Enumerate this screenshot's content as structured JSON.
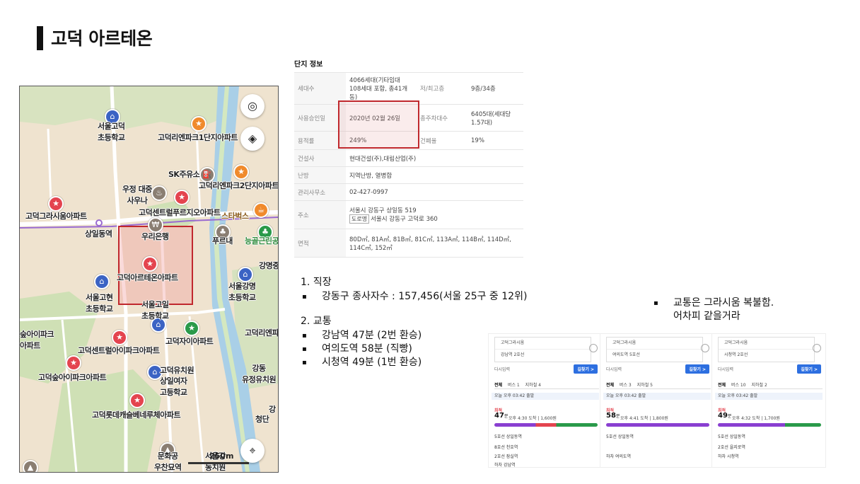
{
  "title": "고덕 아르테온",
  "map": {
    "labels": {
      "seoul_godeok_elem": "서울고덕\n초등학교",
      "ienpark1": "고덕리엔파크1단지아파트",
      "sk": "SK주유소",
      "ujeong": "우정 대중\n사우나",
      "ienpark2": "고덕리엔파크2단지아파트",
      "gracium": "고덕그라시움아파트",
      "centrepruzio": "고덕센트럴푸르지오아파트",
      "starbucks": "스타벅스",
      "sangil_stn": "상일동역",
      "woori": "우리은행",
      "purene": "푸르내",
      "neunggol": "능골근린공",
      "gangmyeong_short": "강명중",
      "arteon": "고덕아르테온아파트",
      "gangmyeong_elem": "서울강명\n초등학교",
      "godeok_high_elem": "서울고현\n초등학교",
      "godeok_il_elem": "서울고일\n초등학교",
      "zai": "고덕자이아파트",
      "ienpark_right": "고덕리엔파",
      "sup_apt": "숲아이파크\n아파트",
      "central_ipark": "고덕센트럴아이파크아파트",
      "sup_ipark": "고덕숲아이파크아파트",
      "kindergarten": "고덕유치원",
      "sangil_girls": "상일여자\n고등학교",
      "gangdong_kinder": "강동\n유정유치원",
      "lotte": "고덕롯데캐슬베네루체아파트",
      "cheongdang": "청단",
      "gang": "강",
      "moonhwa": "문화공\n우찬묘역",
      "seoul_gang": "서울강\n동치원",
      "scale": "250m"
    },
    "buttons": {
      "location_icon": "◎",
      "layers_icon": "◈",
      "gps_icon": "⌖"
    }
  },
  "info": {
    "title": "단지 정보",
    "rows": [
      {
        "k": "세대수",
        "v": "4066세대(기타임대 108세대 포함, 총41개동)",
        "k2": "저/최고층",
        "v2": "9층/34층"
      },
      {
        "k": "사용승인일",
        "v": "2020년 02월 26일",
        "k2": "총주차대수",
        "v2": "6405대(세대당 1.57대)"
      },
      {
        "k": "용적률",
        "v": "249%",
        "k2": "건폐율",
        "v2": "19%"
      },
      {
        "k": "건설사",
        "v": "현대건설(주),대림산업(주)"
      },
      {
        "k": "난방",
        "v": "지역난방, 열병합"
      },
      {
        "k": "관리사무소",
        "v": "02-427-0997"
      },
      {
        "k": "주소",
        "v": "서울시 강동구 상일동 519",
        "badge": "도로명",
        "v_road": "서울시 강동구 고덕로 360"
      },
      {
        "k": "면적",
        "v": "80D㎡, 81A㎡, 81B㎡, 81C㎡, 113A㎡, 114B㎡, 114D㎡, 114C㎡, 152㎡"
      }
    ]
  },
  "notes": {
    "job_heading": "1. 직장",
    "job_item": "강동구 종사자수 : 157,456(서울 25구 중 12위)",
    "traffic_heading": "2. 교통",
    "traffic_items": [
      "강남역 47분 (2번 환승)",
      "여의도역 58분 (직빵)",
      "시청역 49분 (1번 환승)"
    ],
    "side_line1": "교통은 그라시움 복불함.",
    "side_line2": "어차피 같을거라"
  },
  "routes": [
    {
      "from": "고덕그라시움",
      "to": "강남역 2호선",
      "again": "다시입력",
      "find": "길찾기 >",
      "tabs": [
        "전체",
        "버스 1",
        "지하철 4"
      ],
      "time_bar": "오늘 오후 03:42 출발",
      "best": "최적",
      "mins": "47",
      "min_unit": "분",
      "info": "오후 4:30 도착 | 1,600원",
      "bar_color": "#8a3fd1",
      "steps": [
        "5호선 상일동역",
        "8호선 천호역",
        "2호선 잠실역",
        "하차 강남역"
      ]
    },
    {
      "from": "고덕그라시움",
      "to": "여의도역 5호선",
      "again": "다시입력",
      "find": "길찾기 >",
      "tabs": [
        "전체",
        "버스 3",
        "지하철 5"
      ],
      "time_bar": "오늘 오후 03:42 출발",
      "best": "최적",
      "mins": "58",
      "min_unit": "분",
      "info": "오후 4:41 도착 | 1,800원",
      "bar_color": "#8a3fd1",
      "steps": [
        "5호선 상일동역",
        "하차 여의도역"
      ]
    },
    {
      "from": "고덕그라시움",
      "to": "시청역 2호선",
      "again": "다시입력",
      "find": "길찾기 >",
      "tabs": [
        "전체",
        "버스 10",
        "지하철 2"
      ],
      "time_bar": "오늘 오후 03:42 출발",
      "best": "최적",
      "mins": "49",
      "min_unit": "분",
      "info": "오후 4:32 도착 | 1,700원",
      "bar_color": "#8a3fd1",
      "steps": [
        "5호선 상일동역",
        "2호선 을지로역",
        "하차 시청역"
      ]
    }
  ]
}
